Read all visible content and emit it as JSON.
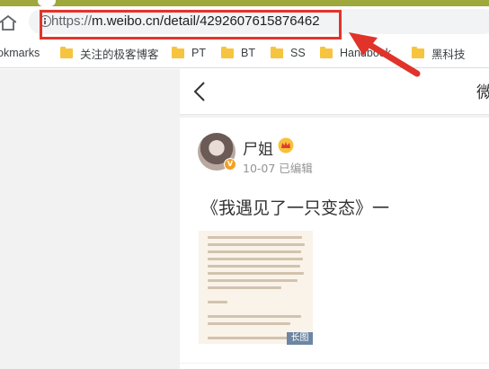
{
  "browser": {
    "url_protocol": "https://",
    "url_rest": "m.weibo.cn/detail/4292607615876462",
    "bookmarks": [
      {
        "label": "okmarks",
        "folder": false
      },
      {
        "label": "关注的极客博客",
        "folder": true
      },
      {
        "label": "PT",
        "folder": true
      },
      {
        "label": "BT",
        "folder": true
      },
      {
        "label": "SS",
        "folder": true
      },
      {
        "label": "Handbook",
        "folder": true
      },
      {
        "label": "黑科技",
        "folder": true
      }
    ]
  },
  "annotation": {
    "highlight_color": "#e0342b"
  },
  "nav": {
    "title": "微"
  },
  "post": {
    "username": "尸姐",
    "meta": "10-07 已编辑",
    "verified_badge": "V",
    "text": "《我遇见了一只变态》一",
    "image_badge": "长图"
  }
}
